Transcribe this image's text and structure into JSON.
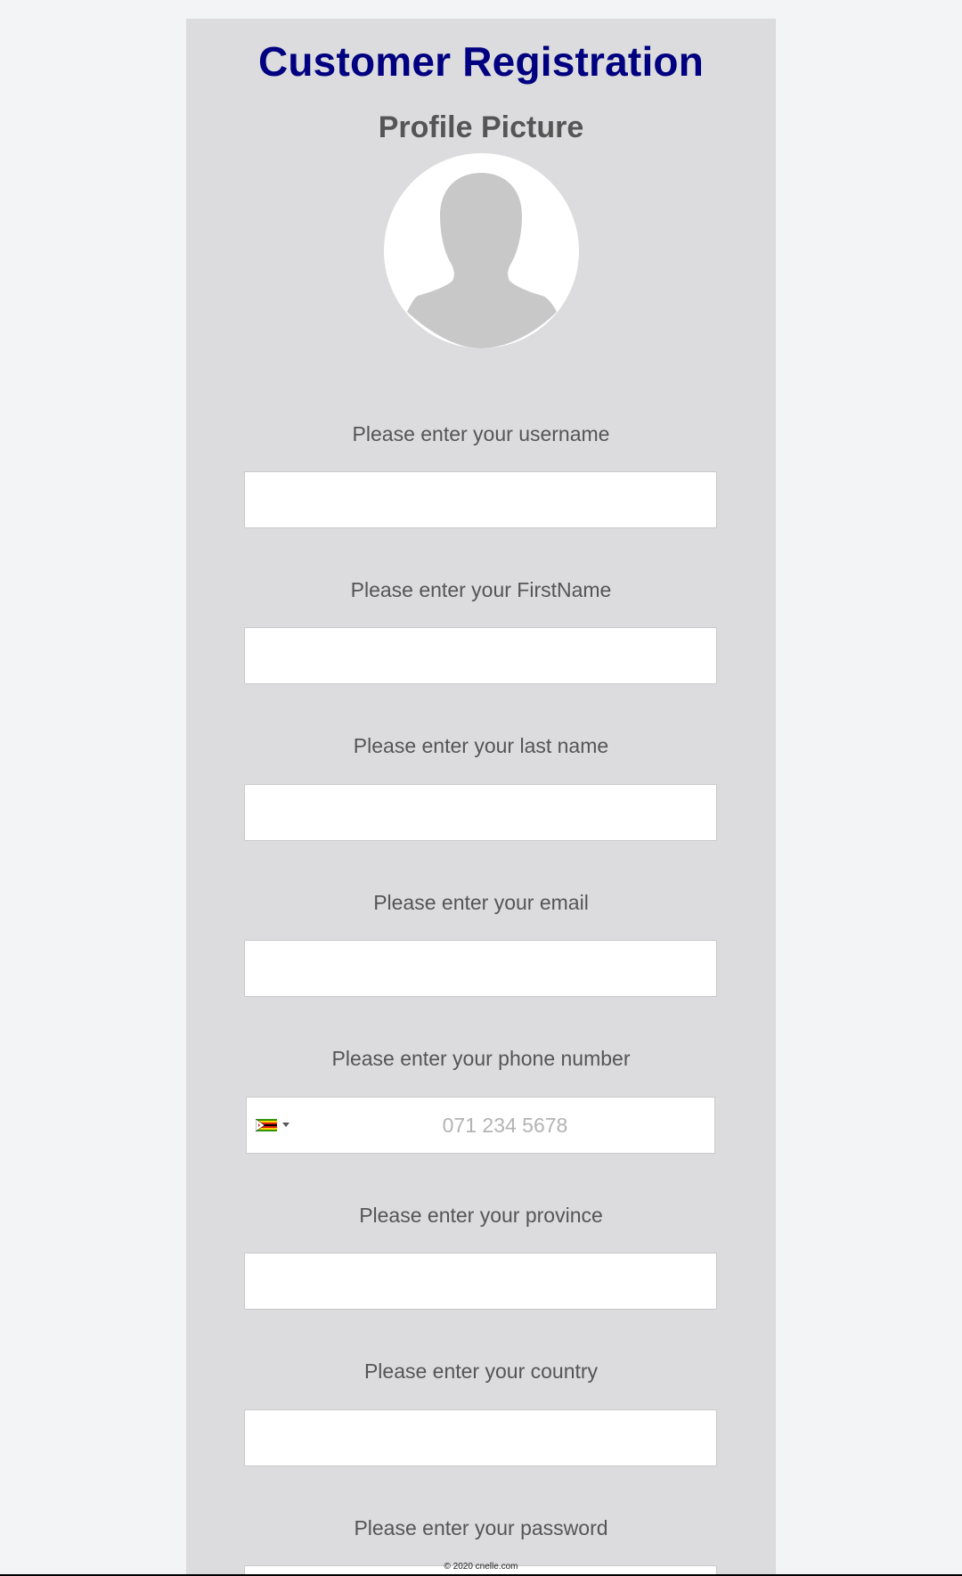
{
  "header": {
    "title": "Customer Registration",
    "subtitle": "Profile Picture"
  },
  "avatar": {
    "icon": "user-silhouette-icon"
  },
  "fields": [
    {
      "label": "Please enter your username",
      "value": "",
      "placeholder": ""
    },
    {
      "label": "Please enter your FirstName",
      "value": "",
      "placeholder": ""
    },
    {
      "label": "Please enter your last name",
      "value": "",
      "placeholder": ""
    },
    {
      "label": "Please enter your email",
      "value": "",
      "placeholder": ""
    },
    {
      "label": "Please enter your phone number",
      "value": "",
      "placeholder": "071 234 5678",
      "country_flag_icon": "zimbabwe-flag-icon"
    },
    {
      "label": "Please enter your province",
      "value": "",
      "placeholder": ""
    },
    {
      "label": "Please enter your country",
      "value": "",
      "placeholder": ""
    },
    {
      "label": "Please enter your password",
      "value": "",
      "placeholder": ""
    }
  ],
  "footer": {
    "text": "© 2020 cnelle.com"
  },
  "colors": {
    "title": "#000080",
    "label": "#555555",
    "card_background": "#dcdcde",
    "page_background": "#f3f4f6"
  }
}
